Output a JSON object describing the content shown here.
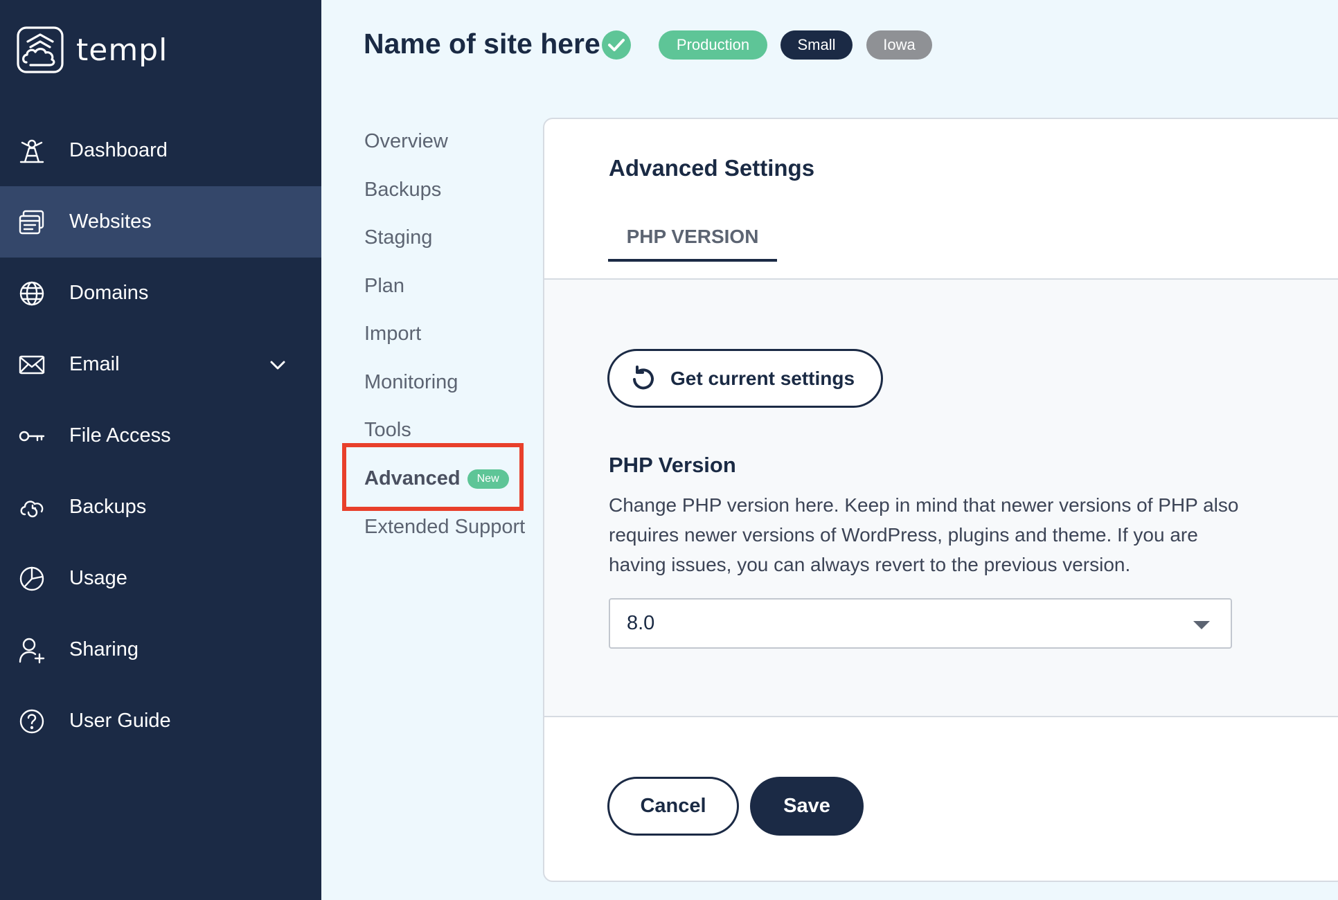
{
  "brand": {
    "name": "templ",
    "logo_icon": "cloud-mountain-logo"
  },
  "sidebar": {
    "items": [
      {
        "label": "Dashboard",
        "icon": "dashboard-icon",
        "active": false
      },
      {
        "label": "Websites",
        "icon": "websites-icon",
        "active": true
      },
      {
        "label": "Domains",
        "icon": "globe-icon",
        "active": false
      },
      {
        "label": "Email",
        "icon": "envelope-icon",
        "active": false,
        "expandable": true
      },
      {
        "label": "File Access",
        "icon": "key-icon",
        "active": false
      },
      {
        "label": "Backups",
        "icon": "backup-cloud-icon",
        "active": false
      },
      {
        "label": "Usage",
        "icon": "pie-chart-icon",
        "active": false
      },
      {
        "label": "Sharing",
        "icon": "add-user-icon",
        "active": false
      },
      {
        "label": "User Guide",
        "icon": "help-circle-icon",
        "active": false
      }
    ]
  },
  "header": {
    "site_name": "Name of site here",
    "badges": {
      "environment": "Production",
      "size": "Small",
      "location": "Iowa"
    }
  },
  "subnav": {
    "items": [
      "Overview",
      "Backups",
      "Staging",
      "Plan",
      "Import",
      "Monitoring",
      "Tools",
      "Advanced",
      "Extended Support"
    ],
    "active": "Advanced",
    "new_pill": "New"
  },
  "panel": {
    "title": "Advanced Settings",
    "tab": "PHP VERSION",
    "get_settings_label": "Get current settings",
    "section_title": "PHP Version",
    "section_desc": "Change PHP version here. Keep in mind that newer versions of PHP also requires newer versions of WordPress, plugins and theme. If you are having issues, you can always revert to the previous version.",
    "php_version": "8.0",
    "cancel_label": "Cancel",
    "save_label": "Save"
  },
  "colors": {
    "sidebar_bg": "#1b2a45",
    "sidebar_active": "#34476a",
    "accent_green": "#5ec597",
    "highlight_red": "#e8402b",
    "page_bg": "#eef8fd"
  }
}
